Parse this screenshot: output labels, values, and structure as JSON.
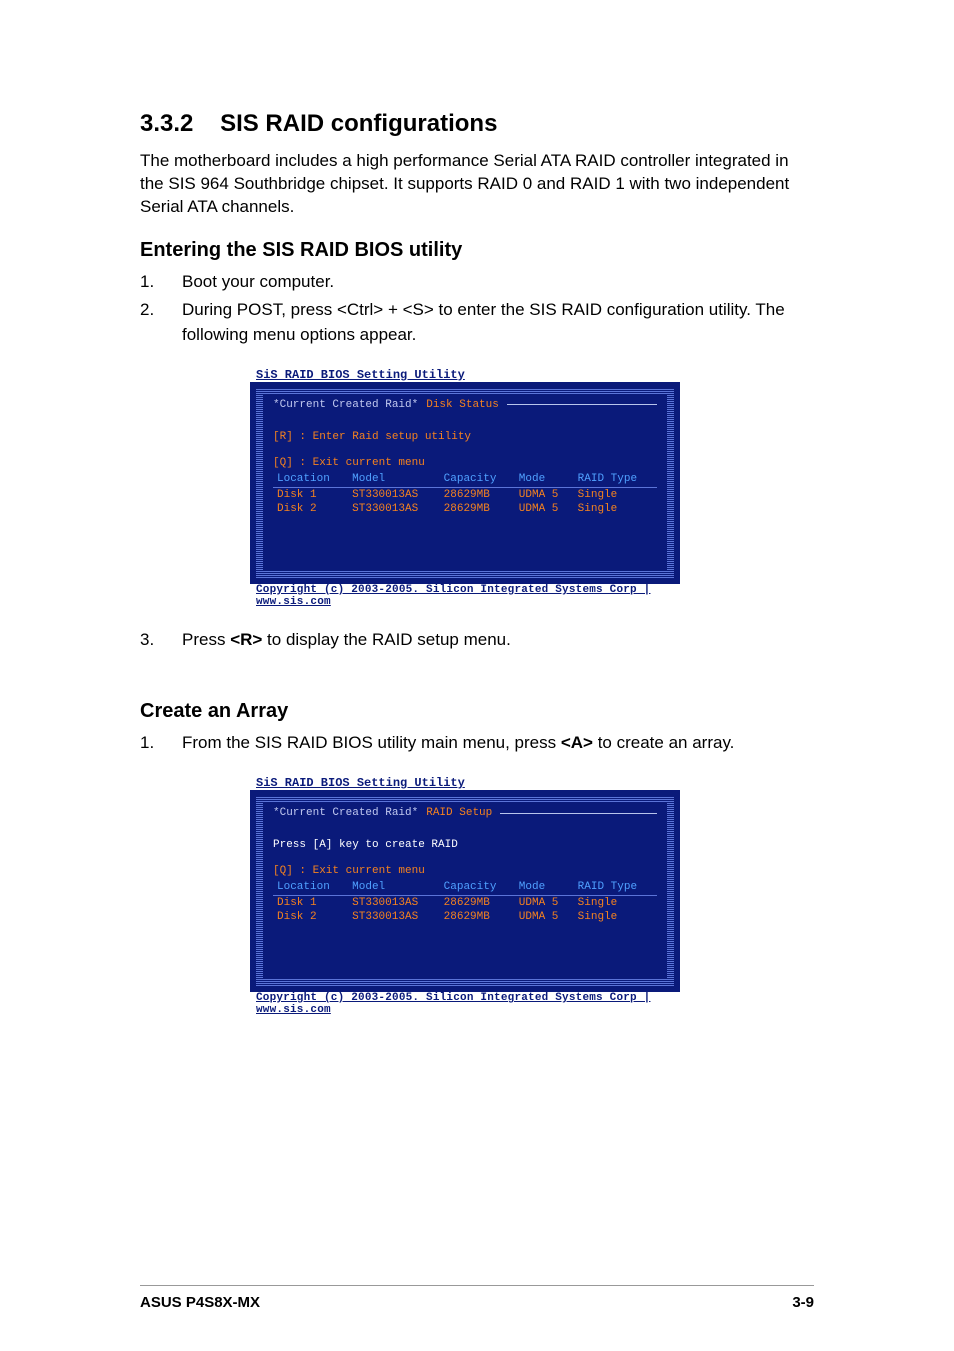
{
  "section": {
    "number": "3.3.2",
    "title": "SIS RAID configurations",
    "intro": "The motherboard includes a high performance Serial ATA RAID controller integrated in the SIS 964 Southbridge chipset. It supports RAID 0 and RAID 1 with two independent Serial ATA channels."
  },
  "sub1": {
    "title": "Entering the SIS RAID BIOS utility",
    "steps": [
      {
        "n": "1.",
        "text": "Boot your computer."
      },
      {
        "n": "2.",
        "text": "During POST, press <Ctrl> + <S> to enter the SIS RAID configuration utility. The following menu options appear."
      },
      {
        "n": "3.",
        "pre": "Press ",
        "key": "<R>",
        "post": " to display the RAID setup menu."
      }
    ]
  },
  "sub2": {
    "title": "Create an Array",
    "steps": [
      {
        "n": "1.",
        "pre": "From the SIS RAID BIOS utility main menu, press ",
        "key": "<A>",
        "post": " to create an array."
      }
    ]
  },
  "bios1": {
    "app_title": "SiS RAID BIOS Setting Utility",
    "header_label": "*Current Created Raid*",
    "tab": "Disk Status",
    "hint1": "[R] : Enter Raid setup utility",
    "hint2": "[Q] : Exit current menu",
    "columns": [
      "Location",
      "Model",
      "Capacity",
      "Mode",
      "RAID Type"
    ],
    "rows": [
      {
        "location": "Disk 1",
        "model": "ST330013AS",
        "capacity": "28629MB",
        "mode": "UDMA 5",
        "raid": "Single"
      },
      {
        "location": "Disk 2",
        "model": "ST330013AS",
        "capacity": "28629MB",
        "mode": "UDMA 5",
        "raid": "Single"
      }
    ],
    "footer": "Copyright (c) 2003-2005. Silicon Integrated Systems Corp   |   www.sis.com"
  },
  "bios2": {
    "app_title": "SiS RAID BIOS Setting Utility",
    "header_label": "*Current Created Raid*",
    "tab": "RAID Setup",
    "hint1": "Press [A] key to create RAID",
    "hint2": "[Q] : Exit current menu",
    "columns": [
      "Location",
      "Model",
      "Capacity",
      "Mode",
      "RAID Type"
    ],
    "rows": [
      {
        "location": "Disk 1",
        "model": "ST330013AS",
        "capacity": "28629MB",
        "mode": "UDMA 5",
        "raid": "Single"
      },
      {
        "location": "Disk 2",
        "model": "ST330013AS",
        "capacity": "28629MB",
        "mode": "UDMA 5",
        "raid": "Single"
      }
    ],
    "footer": "Copyright (c) 2003-2005. Silicon Integrated Systems Corp   |   www.sis.com"
  },
  "footer": {
    "left": "ASUS P4S8X-MX",
    "right": "3-9"
  }
}
